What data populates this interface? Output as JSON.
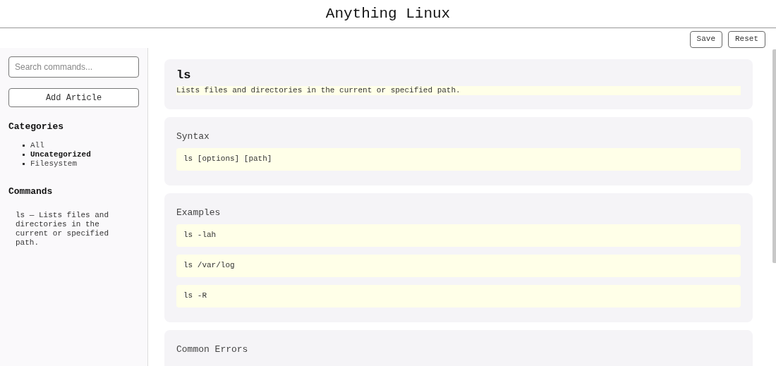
{
  "header": {
    "title": "Anything Linux"
  },
  "toolbar": {
    "buttons": [
      "Save",
      "Reset"
    ]
  },
  "sidebar": {
    "search": {
      "placeholder": "Search commands..."
    },
    "add_button": "Add Article",
    "categories_heading": "Categories",
    "categories": [
      {
        "label": "All",
        "selected": false
      },
      {
        "label": "Uncategorized",
        "selected": true
      },
      {
        "label": "Filesystem",
        "selected": false
      }
    ],
    "commands_heading": "Commands",
    "commands": [
      "ls — Lists files and directories in the current or specified path."
    ]
  },
  "article": {
    "title": "ls",
    "description": "Lists files and directories in the current or specified path.",
    "sections": [
      {
        "heading": "Syntax",
        "blocks": [
          "ls [options] [path]"
        ]
      },
      {
        "heading": "Examples",
        "blocks": [
          "ls -lah",
          "ls /var/log",
          "ls -R"
        ]
      },
      {
        "heading": "Common Errors"
      }
    ]
  }
}
